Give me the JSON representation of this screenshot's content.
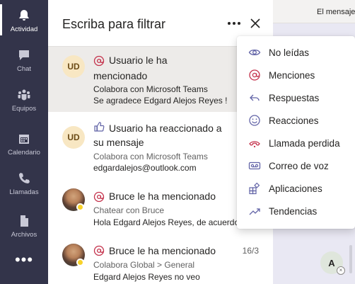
{
  "rail": {
    "items": [
      {
        "label": "Actividad"
      },
      {
        "label": "Chat"
      },
      {
        "label": "Equipos"
      },
      {
        "label": "Calendario"
      },
      {
        "label": "Llamadas"
      },
      {
        "label": "Archivos"
      }
    ],
    "more": "•••"
  },
  "panel": {
    "title": "Escriba para filtrar"
  },
  "feed": [
    {
      "initials": "UD",
      "title_line1": "Usuario le ha",
      "title_line2": "mencionado",
      "context": "Colabora con Microsoft Teams",
      "preview": "Se agradece Edgard Alejos Reyes !",
      "icon": "mention-icon"
    },
    {
      "initials": "UD",
      "title_line1": "Usuario ha reaccionado a",
      "title_line2": "su mensaje",
      "context": "Colabora con Microsoft Teams",
      "preview": "edgardalejos@outlook.com",
      "icon": "like-icon"
    },
    {
      "title_line1": "Bruce le ha mencionado",
      "context": "Chatear con Bruce",
      "preview": "Hola Edgard Alejos Reyes, de acuerdo",
      "icon": "mention-icon"
    },
    {
      "title_line1": "Bruce le ha mencionado",
      "date": "16/3",
      "context": "Colabora Global > General",
      "preview": "Edgard Alejos Reyes no veo",
      "icon": "mention-icon"
    }
  ],
  "right": {
    "header_text": "El mensaje",
    "avatar_initial": "A"
  },
  "menu": {
    "items": [
      {
        "label": "No leídas",
        "icon": "eye-icon"
      },
      {
        "label": "Menciones",
        "icon": "mention-icon"
      },
      {
        "label": "Respuestas",
        "icon": "reply-icon"
      },
      {
        "label": "Reacciones",
        "icon": "smile-icon"
      },
      {
        "label": "Llamada perdida",
        "icon": "missed-call-icon"
      },
      {
        "label": "Correo de voz",
        "icon": "voicemail-icon"
      },
      {
        "label": "Aplicaciones",
        "icon": "apps-icon"
      },
      {
        "label": "Tendencias",
        "icon": "trending-icon"
      }
    ]
  },
  "colors": {
    "rail": "#33344a",
    "accent": "#6264a7",
    "mention": "#c4314b",
    "presence_away": "#f8d22a"
  }
}
